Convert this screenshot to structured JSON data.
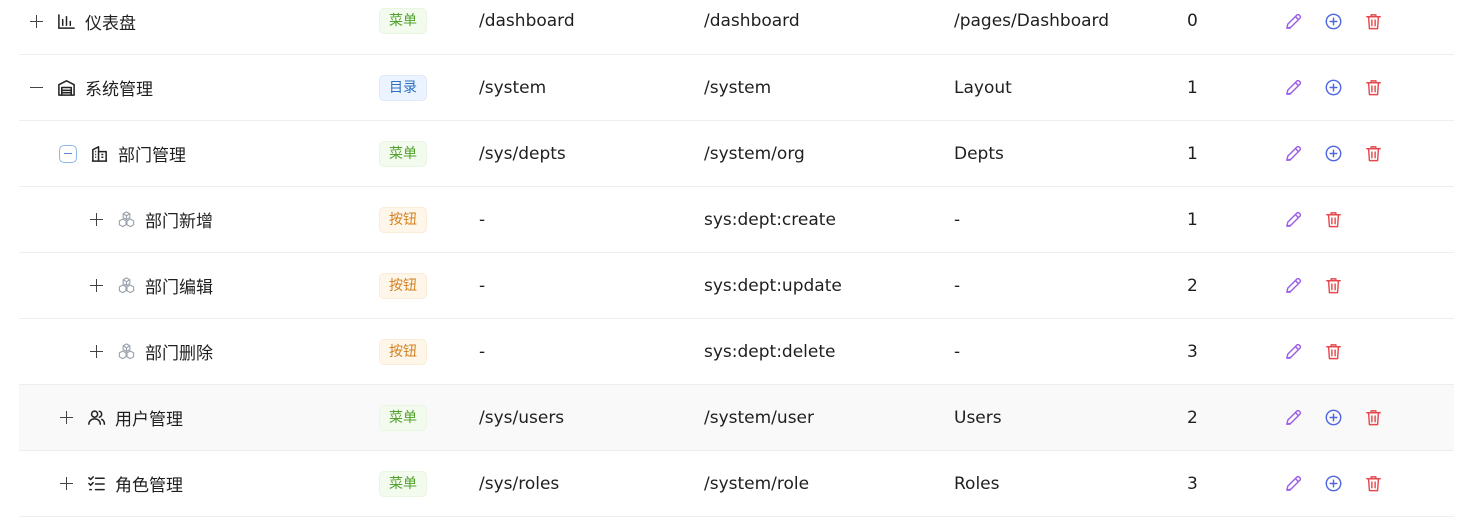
{
  "colors": {
    "edit": "#9b5de5",
    "add": "#4f66e0",
    "delete": "#e5484d",
    "tag_menu_text": "#52a12f",
    "tag_dir_text": "#2f6fc0",
    "tag_button_text": "#d2801f"
  },
  "rows": [
    {
      "name": "仪表盘",
      "icon": "bar-chart-icon",
      "expander": "plus",
      "level": 0,
      "type": "菜单",
      "route": "/dashboard",
      "permission": "/dashboard",
      "component": "/pages/Dashboard",
      "order": "0",
      "ops": [
        "edit",
        "add",
        "delete"
      ]
    },
    {
      "name": "系统管理",
      "icon": "warehouse-icon",
      "expander": "minus",
      "level": 0,
      "type": "目录",
      "route": "/system",
      "permission": "/system",
      "component": "Layout",
      "order": "1",
      "ops": [
        "edit",
        "add",
        "delete"
      ]
    },
    {
      "name": "部门管理",
      "icon": "building-icon",
      "expander": "minus-boxed",
      "level": 1,
      "type": "菜单",
      "route": "/sys/depts",
      "permission": "/system/org",
      "component": "Depts",
      "order": "1",
      "ops": [
        "edit",
        "add",
        "delete"
      ]
    },
    {
      "name": "部门新增",
      "icon": "cubes-icon",
      "expander": "plus",
      "level": 2,
      "type": "按钮",
      "route": "-",
      "permission": "sys:dept:create",
      "component": "-",
      "order": "1",
      "ops": [
        "edit",
        "delete"
      ]
    },
    {
      "name": "部门编辑",
      "icon": "cubes-icon",
      "expander": "plus",
      "level": 2,
      "type": "按钮",
      "route": "-",
      "permission": "sys:dept:update",
      "component": "-",
      "order": "2",
      "ops": [
        "edit",
        "delete"
      ]
    },
    {
      "name": "部门删除",
      "icon": "cubes-icon",
      "expander": "plus",
      "level": 2,
      "type": "按钮",
      "route": "-",
      "permission": "sys:dept:delete",
      "component": "-",
      "order": "3",
      "ops": [
        "edit",
        "delete"
      ]
    },
    {
      "name": "用户管理",
      "icon": "users-icon",
      "expander": "plus",
      "level": 1,
      "type": "菜单",
      "route": "/sys/users",
      "permission": "/system/user",
      "component": "Users",
      "order": "2",
      "ops": [
        "edit",
        "add",
        "delete"
      ],
      "hover": true
    },
    {
      "name": "角色管理",
      "icon": "list-check-icon",
      "expander": "plus",
      "level": 1,
      "type": "菜单",
      "route": "/sys/roles",
      "permission": "/system/role",
      "component": "Roles",
      "order": "3",
      "ops": [
        "edit",
        "add",
        "delete"
      ]
    }
  ]
}
